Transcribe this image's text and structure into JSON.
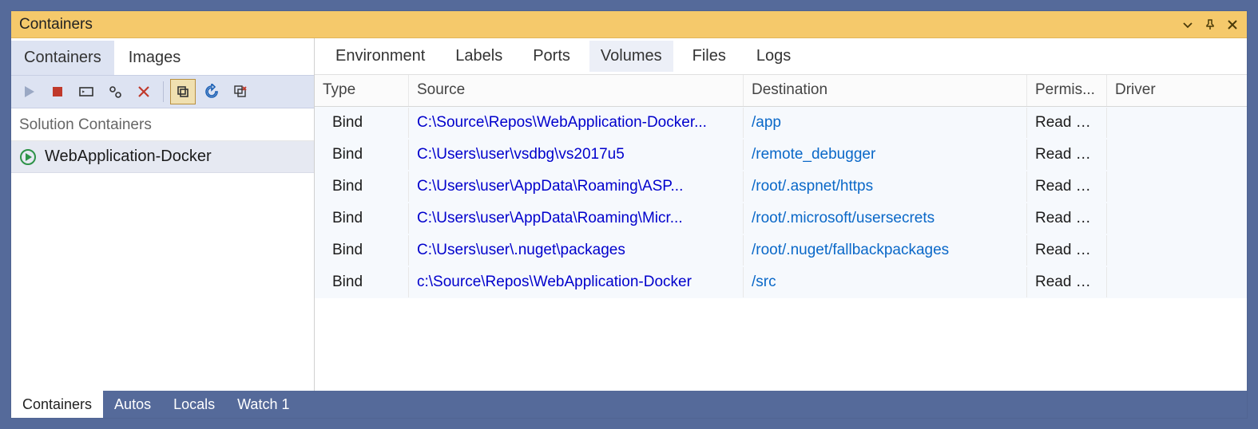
{
  "window": {
    "title": "Containers"
  },
  "left_tabs": [
    "Containers",
    "Images"
  ],
  "left_active_tab": 0,
  "section_label": "Solution Containers",
  "containers": [
    {
      "name": "WebApplication-Docker",
      "running": true
    }
  ],
  "detail_tabs": [
    "Environment",
    "Labels",
    "Ports",
    "Volumes",
    "Files",
    "Logs"
  ],
  "detail_active_tab": 3,
  "columns": [
    "Type",
    "Source",
    "Destination",
    "Permis...",
    "Driver"
  ],
  "volumes": [
    {
      "type": "Bind",
      "source": "C:\\Source\\Repos\\WebApplication-Docker...",
      "dest": "/app",
      "perm": "Read write",
      "driver": ""
    },
    {
      "type": "Bind",
      "source": "C:\\Users\\user\\vsdbg\\vs2017u5",
      "dest": "/remote_debugger",
      "perm": "Read write",
      "driver": ""
    },
    {
      "type": "Bind",
      "source": "C:\\Users\\user\\AppData\\Roaming\\ASP...",
      "dest": "/root/.aspnet/https",
      "perm": "Read only",
      "driver": ""
    },
    {
      "type": "Bind",
      "source": "C:\\Users\\user\\AppData\\Roaming\\Micr...",
      "dest": "/root/.microsoft/usersecrets",
      "perm": "Read only",
      "driver": ""
    },
    {
      "type": "Bind",
      "source": "C:\\Users\\user\\.nuget\\packages",
      "dest": "/root/.nuget/fallbackpackages",
      "perm": "Read write",
      "driver": ""
    },
    {
      "type": "Bind",
      "source": "c:\\Source\\Repos\\WebApplication-Docker",
      "dest": "/src",
      "perm": "Read write",
      "driver": ""
    }
  ],
  "bottom_tabs": [
    "Containers",
    "Autos",
    "Locals",
    "Watch 1"
  ],
  "bottom_active_tab": 0
}
